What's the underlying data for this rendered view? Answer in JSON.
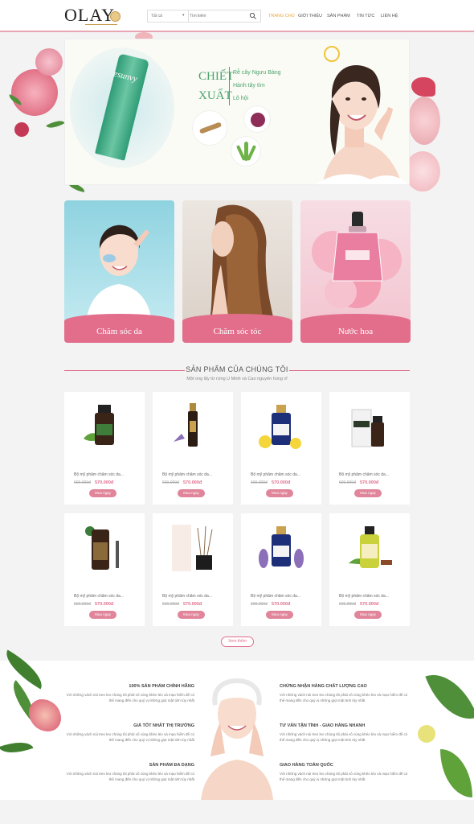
{
  "header": {
    "logo": "OLAY",
    "search": {
      "category": "Tất cả",
      "placeholder": "Tìm kiếm"
    },
    "nav": [
      {
        "label": "Trang chủ",
        "active": true
      },
      {
        "label": "Giới thiệu",
        "active": false
      },
      {
        "label": "Sản phẩm",
        "active": false
      },
      {
        "label": "Tin tức",
        "active": false
      },
      {
        "label": "Liên hệ",
        "active": false
      }
    ]
  },
  "banner": {
    "brand": "esunvy",
    "title_lines": [
      "CHIẾT",
      "XUẤT"
    ],
    "ingredients": [
      "Rễ cây Ngưu Bàng",
      "Hành tây tím",
      "Lô hội"
    ]
  },
  "categories": [
    {
      "label": "Chăm sóc da"
    },
    {
      "label": "Chăm sóc tóc"
    },
    {
      "label": "Nước hoa"
    }
  ],
  "products_section": {
    "title": "SẢN PHẨM CỦA CHÚNG TÔI",
    "subtitle": "Một ong lấy từ rừng U Minh và Cao nguyên hùng vĩ"
  },
  "products": [
    {
      "name": "Bộ mỹ phẩm chăm sóc da...",
      "old_price": "600.000đ",
      "price": "570.000đ",
      "button": "Mua ngay"
    },
    {
      "name": "Bộ mỹ phẩm chăm sóc da...",
      "old_price": "600.000đ",
      "price": "570.000đ",
      "button": "Mua ngay"
    },
    {
      "name": "Bộ mỹ phẩm chăm sóc da...",
      "old_price": "600.000đ",
      "price": "570.000đ",
      "button": "Mua ngay"
    },
    {
      "name": "Bộ mỹ phẩm chăm sóc da...",
      "old_price": "600.000đ",
      "price": "570.000đ",
      "button": "Mua ngay"
    },
    {
      "name": "Bộ mỹ phẩm chăm sóc da...",
      "old_price": "600.000đ",
      "price": "570.000đ",
      "button": "Mua ngay"
    },
    {
      "name": "Bộ mỹ phẩm chăm sóc da...",
      "old_price": "600.000đ",
      "price": "570.000đ",
      "button": "Mua ngay"
    },
    {
      "name": "Bộ mỹ phẩm chăm sóc da...",
      "old_price": "600.000đ",
      "price": "570.000đ",
      "button": "Mua ngay"
    },
    {
      "name": "Bộ mỹ phẩm chăm sóc da...",
      "old_price": "600.000đ",
      "price": "570.000đ",
      "button": "Mua ngay"
    }
  ],
  "more_button": "Xem thêm",
  "features": [
    {
      "title": "100% sản phẩm chính hãng",
      "desc": "Với những vách núi treo leo chúng tôi phải vô cùng khéo léo và mạo hiểm để có thể mang đến cho quý vị những giọt mật tinh túy nhất"
    },
    {
      "title": "Giá tốt nhất thị trường",
      "desc": "Với những vách núi treo leo chúng tôi phải vô cùng khéo léo và mạo hiểm để có thể mang đến cho quý vị những giọt mật tinh túy nhất"
    },
    {
      "title": "Sản phẩm đa dạng",
      "desc": "Với những vách núi treo leo chúng tôi phải vô cùng khéo léo và mạo hiểm để có thể mang đến cho quý vị những giọt mật tinh túy nhất"
    },
    {
      "title": "Chứng nhận hàng chất lượng cao",
      "desc": "Với những vách núi treo leo chúng tôi phải vô cùng khéo léo và mạo hiểm để có thể mang đến cho quý vị những giọt mật tinh túy nhất"
    },
    {
      "title": "Tư vấn tận tình - Giao hàng nhanh",
      "desc": "Với những vách núi treo leo chúng tôi phải vô cùng khéo léo và mạo hiểm để có thể mang đến cho quý vị những giọt mật tinh túy nhất"
    },
    {
      "title": "Giao hàng toàn quốc",
      "desc": "Với những vách núi treo leo chúng tôi phải vô cùng khéo léo và mạo hiểm để có thể mang đến cho quý vị những giọt mật tinh túy nhất"
    }
  ],
  "colors": {
    "accent": "#e26e8c",
    "nav_active": "#e8a83a",
    "banner_green": "#4aa36b"
  }
}
